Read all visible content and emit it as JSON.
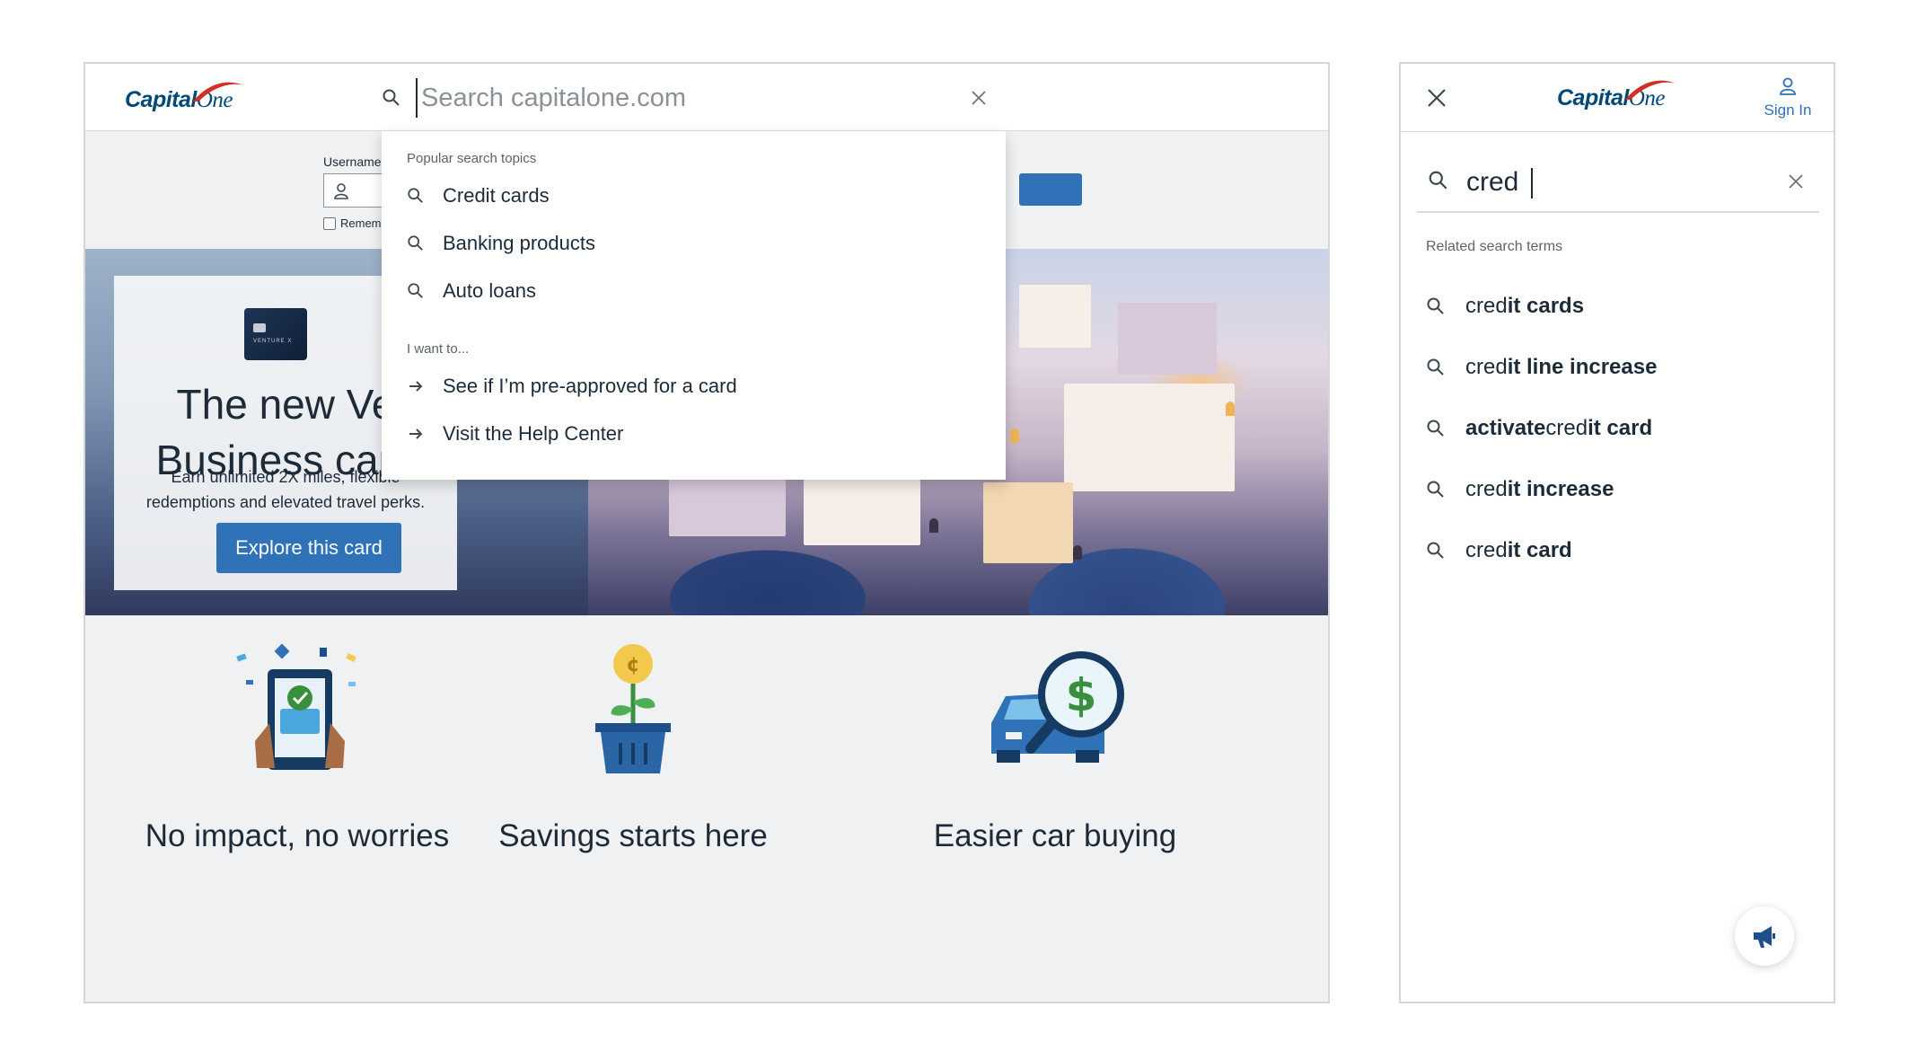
{
  "brand": {
    "logo_text_capital": "Capital",
    "logo_text_one": "One",
    "navy": "#004977",
    "red": "#d03027",
    "accent_blue": "#2f72b7"
  },
  "desktop": {
    "search": {
      "placeholder": "Search capitalone.com",
      "value": ""
    },
    "login": {
      "username_label": "Username",
      "remember_label": "Remem"
    },
    "dropdown": {
      "popular_heading": "Popular search topics",
      "popular": [
        {
          "label": "Credit cards",
          "icon": "search-icon"
        },
        {
          "label": "Banking products",
          "icon": "search-icon"
        },
        {
          "label": "Auto loans",
          "icon": "search-icon"
        }
      ],
      "want_heading": "I want to...",
      "actions": [
        {
          "label": "See if I’m pre-approved for a card",
          "icon": "arrow-right-icon"
        },
        {
          "label": "Visit the Help Center",
          "icon": "arrow-right-icon"
        }
      ]
    },
    "promo": {
      "card_text": "VENTURE X",
      "title_line1": "The new Ve",
      "title_line2": "Business card",
      "description": "Earn unlimited 2X miles, flexible redemptions and elevated travel perks.",
      "button_label": "Explore this card"
    },
    "features": [
      {
        "title": "No impact, no worries",
        "icon": "tablet-approval-icon"
      },
      {
        "title": "Savings starts here",
        "icon": "money-plant-icon"
      },
      {
        "title": "Easier car buying",
        "icon": "car-magnifier-icon"
      }
    ]
  },
  "mobile": {
    "signin_label": "Sign In",
    "search": {
      "value": "cred"
    },
    "related_heading": "Related search terms",
    "suggestions": [
      {
        "prefix": "",
        "match": "cred",
        "suffix": "it cards"
      },
      {
        "prefix": "",
        "match": "cred",
        "suffix": "it line increase"
      },
      {
        "prefix": "activate ",
        "match": "cred",
        "suffix": "it card"
      },
      {
        "prefix": "",
        "match": "cred",
        "suffix": "it increase"
      },
      {
        "prefix": "",
        "match": "cred",
        "suffix": "it card"
      }
    ]
  }
}
